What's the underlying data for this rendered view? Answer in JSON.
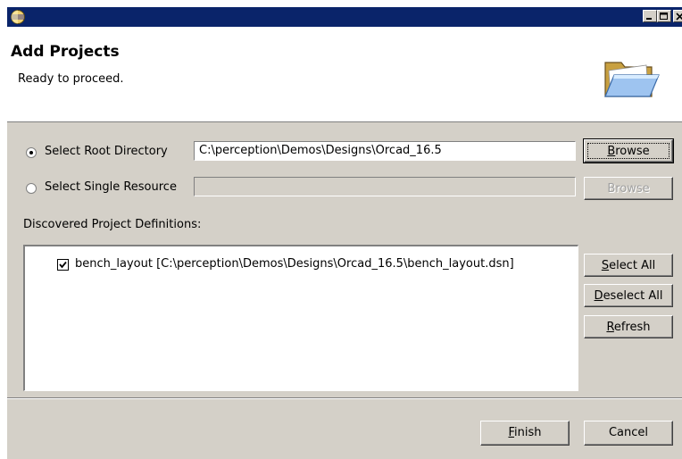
{
  "window": {
    "title": ""
  },
  "header": {
    "title": "Add Projects",
    "message": "Ready to proceed."
  },
  "options": {
    "root": {
      "label": "Select Root Directory",
      "checked": true,
      "value": "C:\\perception\\Demos\\Designs\\Orcad_16.5",
      "browse_label": "Browse"
    },
    "single": {
      "label": "Select Single Resource",
      "checked": false,
      "value": "",
      "browse_label": "Browse"
    }
  },
  "discovered": {
    "label": "Discovered Project Definitions:",
    "items": [
      {
        "checked": true,
        "label": "bench_layout [C:\\perception\\Demos\\Designs\\Orcad_16.5\\bench_layout.dsn]"
      }
    ]
  },
  "side_buttons": {
    "select_all": {
      "accel": "S",
      "rest": "elect All"
    },
    "deselect_all": {
      "accel": "D",
      "rest": "eselect All"
    },
    "refresh": {
      "accel": "R",
      "rest": "efresh"
    }
  },
  "footer": {
    "finish": {
      "accel": "F",
      "rest": "inish"
    },
    "cancel": "Cancel"
  },
  "colors": {
    "titlebar": "#0a246a",
    "face": "#d4d0c8"
  },
  "icons": {
    "app": "eclipse-icon",
    "header": "open-folder-icon"
  }
}
